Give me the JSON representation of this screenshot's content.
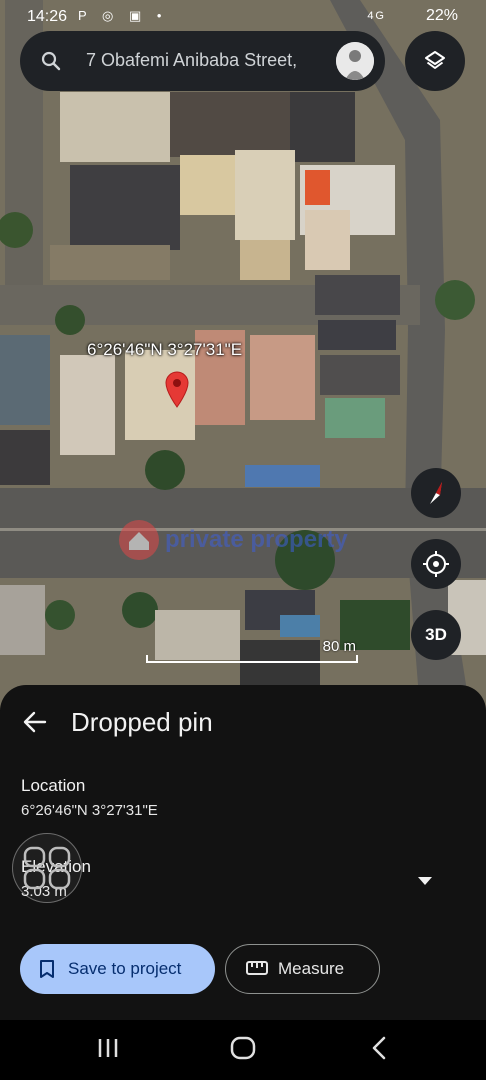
{
  "status_bar": {
    "time": "14:26",
    "left_glyphs": "P ◎ ▣ •",
    "network": "4G",
    "battery": "22%"
  },
  "search": {
    "query": "7 Obafemi Anibaba Street,"
  },
  "map": {
    "coordinates_label": "6°26'46\"N 3°27'31\"E",
    "watermark": "private property",
    "scale_label": "80 m",
    "btn_3d": "3D",
    "pin_color": "#e53935"
  },
  "sheet": {
    "title": "Dropped pin",
    "location_heading": "Location",
    "location_value": "6°26'46\"N 3°27'31\"E",
    "elevation_heading": "Elevation",
    "elevation_value": "3.03 m",
    "save_label": "Save to project",
    "measure_label": "Measure"
  },
  "colors": {
    "save_bg": "#a8c7fa",
    "sheet_bg": "#121212",
    "control_bg": "#1f2226"
  }
}
